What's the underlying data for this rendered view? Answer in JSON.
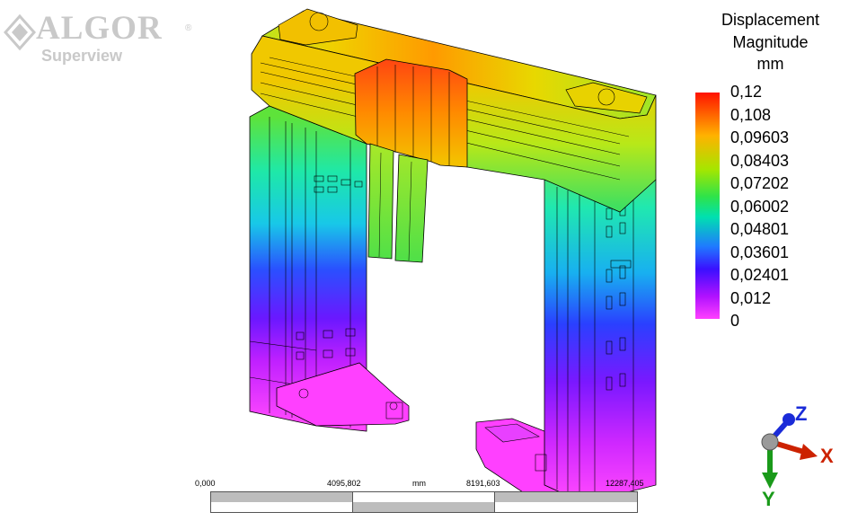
{
  "logo": {
    "title": "ALGOR",
    "registered": "®",
    "subtitle": "Superview"
  },
  "legend": {
    "title_lines": [
      "Displacement",
      "Magnitude",
      "mm"
    ],
    "values": [
      "0,12",
      "0,108",
      "0,09603",
      "0,08403",
      "0,07202",
      "0,06002",
      "0,04801",
      "0,03601",
      "0,02401",
      "0,012",
      "0"
    ],
    "colors": {
      "max": "#ff1200",
      "high": "#ffb200",
      "mid": "#2ee34a",
      "low": "#1f7aff",
      "min": "#ff40ff"
    }
  },
  "scale_bar": {
    "tick_labels": [
      "0,000",
      "4095,802",
      "mm",
      "8191,603",
      "12287,405"
    ]
  },
  "triad": {
    "z_label": "Z",
    "x_label": "X",
    "y_label": "Y",
    "colors": {
      "z": "#1a2bd8",
      "x": "#cc2200",
      "y": "#1a9a1a"
    }
  },
  "model": {
    "icon": "deformed-gantry-structure"
  }
}
